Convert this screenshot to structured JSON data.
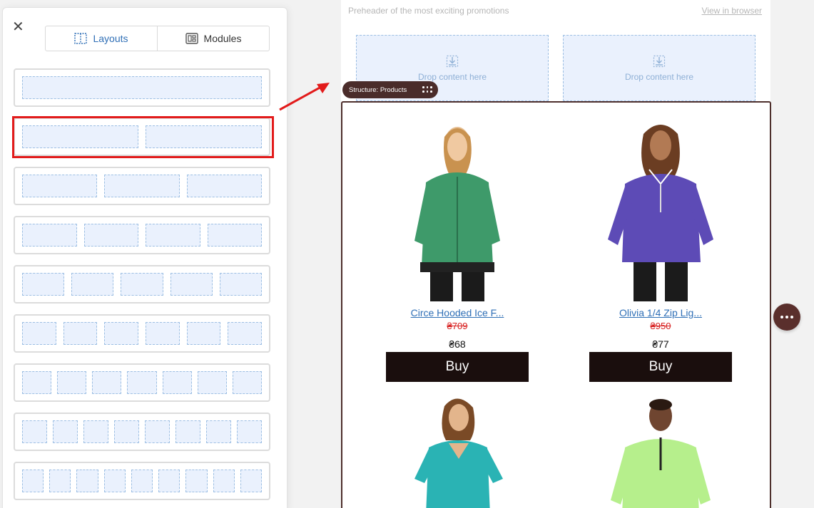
{
  "sidebar": {
    "tabs": [
      {
        "label": "Layouts",
        "icon": "layouts-icon",
        "active": true
      },
      {
        "label": "Modules",
        "icon": "modules-icon",
        "active": false
      }
    ],
    "layouts": [
      {
        "columns": 1
      },
      {
        "columns": 2,
        "highlighted": true
      },
      {
        "columns": 3
      },
      {
        "columns": 4
      },
      {
        "columns": 5
      },
      {
        "columns": 6
      },
      {
        "columns": 7
      },
      {
        "columns": 8
      },
      {
        "columns": 9
      }
    ]
  },
  "email": {
    "preheader": "Preheader of the most exciting promotions",
    "view_in_browser": "View in browser",
    "drop_zones": [
      {
        "label": "Drop content here"
      },
      {
        "label": "Drop content here"
      }
    ],
    "structure_tag": "Structure: Products",
    "products": [
      {
        "name": "Circe Hooded Ice F...",
        "old_price": "₴709",
        "price": "₴68",
        "buy": "Buy",
        "shirt_color": "#3e9a6a"
      },
      {
        "name": "Olivia 1/4 Zip Lig...",
        "old_price": "₴950",
        "price": "₴77",
        "buy": "Buy",
        "shirt_color": "#5d4bb6"
      },
      {
        "name": "",
        "old_price": "",
        "price": "",
        "buy": "",
        "shirt_color": "#2ab3b4"
      },
      {
        "name": "",
        "old_price": "",
        "price": "",
        "buy": "",
        "shirt_color": "#b6ef8c"
      }
    ]
  },
  "colors": {
    "accent": "#2f6fb6",
    "highlight": "#e21b1b",
    "structure": "#4a2c2a",
    "button": "#1a0e0d"
  }
}
